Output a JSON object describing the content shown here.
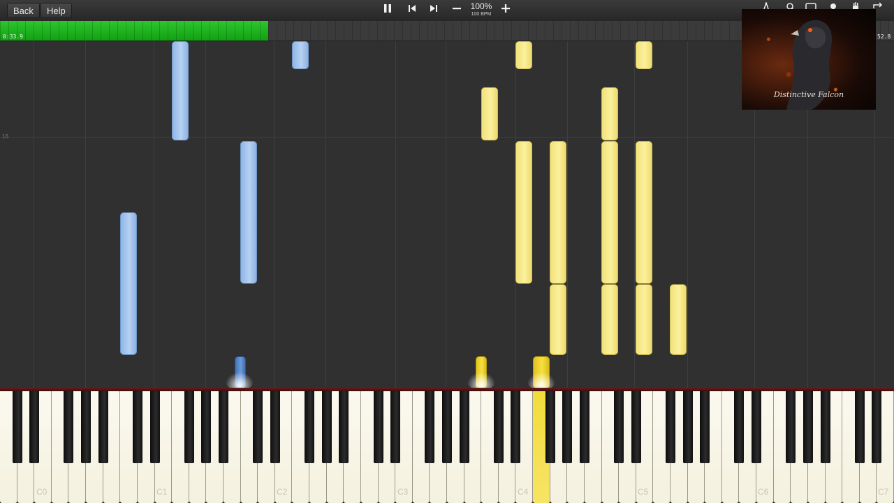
{
  "toolbar": {
    "back_label": "Back",
    "help_label": "Help",
    "speed_percent": "100%",
    "tempo": "100 BPM",
    "pause_icon": "pause-icon",
    "prev_icon": "skip-back-icon",
    "next_icon": "skip-forward-icon",
    "minus_icon": "minus-icon",
    "plus_icon": "plus-icon"
  },
  "progress": {
    "elapsed": "0:33.9",
    "total": "52.8",
    "fraction": 0.3
  },
  "roll": {
    "measure_label": "16"
  },
  "keyboard": {
    "octave_labels": [
      "C0",
      "C1",
      "C2",
      "C3",
      "C4",
      "C5",
      "C6",
      "C7"
    ]
  },
  "thumbnail": {
    "caption": "Distinctive Falcon"
  },
  "colors": {
    "left_hand": "#9cbfe9",
    "right_hand": "#f7ec8c",
    "progress": "#22b522"
  }
}
